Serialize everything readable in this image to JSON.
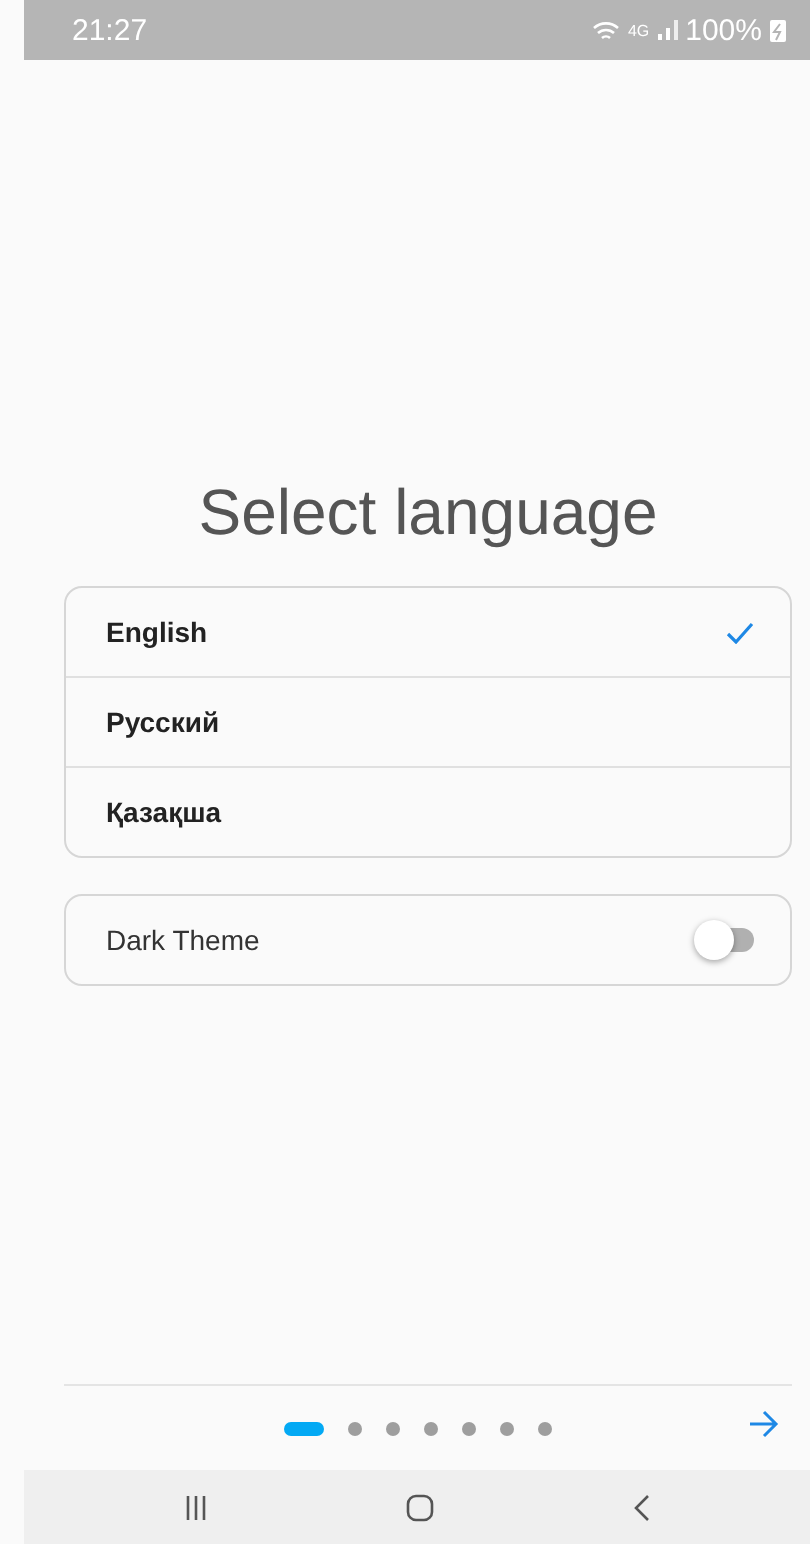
{
  "status_bar": {
    "time": "21:27",
    "network": "4G",
    "battery": "100%"
  },
  "title": "Select language",
  "languages": [
    {
      "label": "English",
      "selected": true
    },
    {
      "label": "Русский",
      "selected": false
    },
    {
      "label": "Қазақша",
      "selected": false
    }
  ],
  "dark_theme": {
    "label": "Dark Theme",
    "on": false
  },
  "pager": [
    {
      "selected": true
    },
    {
      "selected": false
    },
    {
      "selected": false
    },
    {
      "selected": false
    },
    {
      "selected": false
    },
    {
      "selected": false
    },
    {
      "selected": false
    }
  ]
}
